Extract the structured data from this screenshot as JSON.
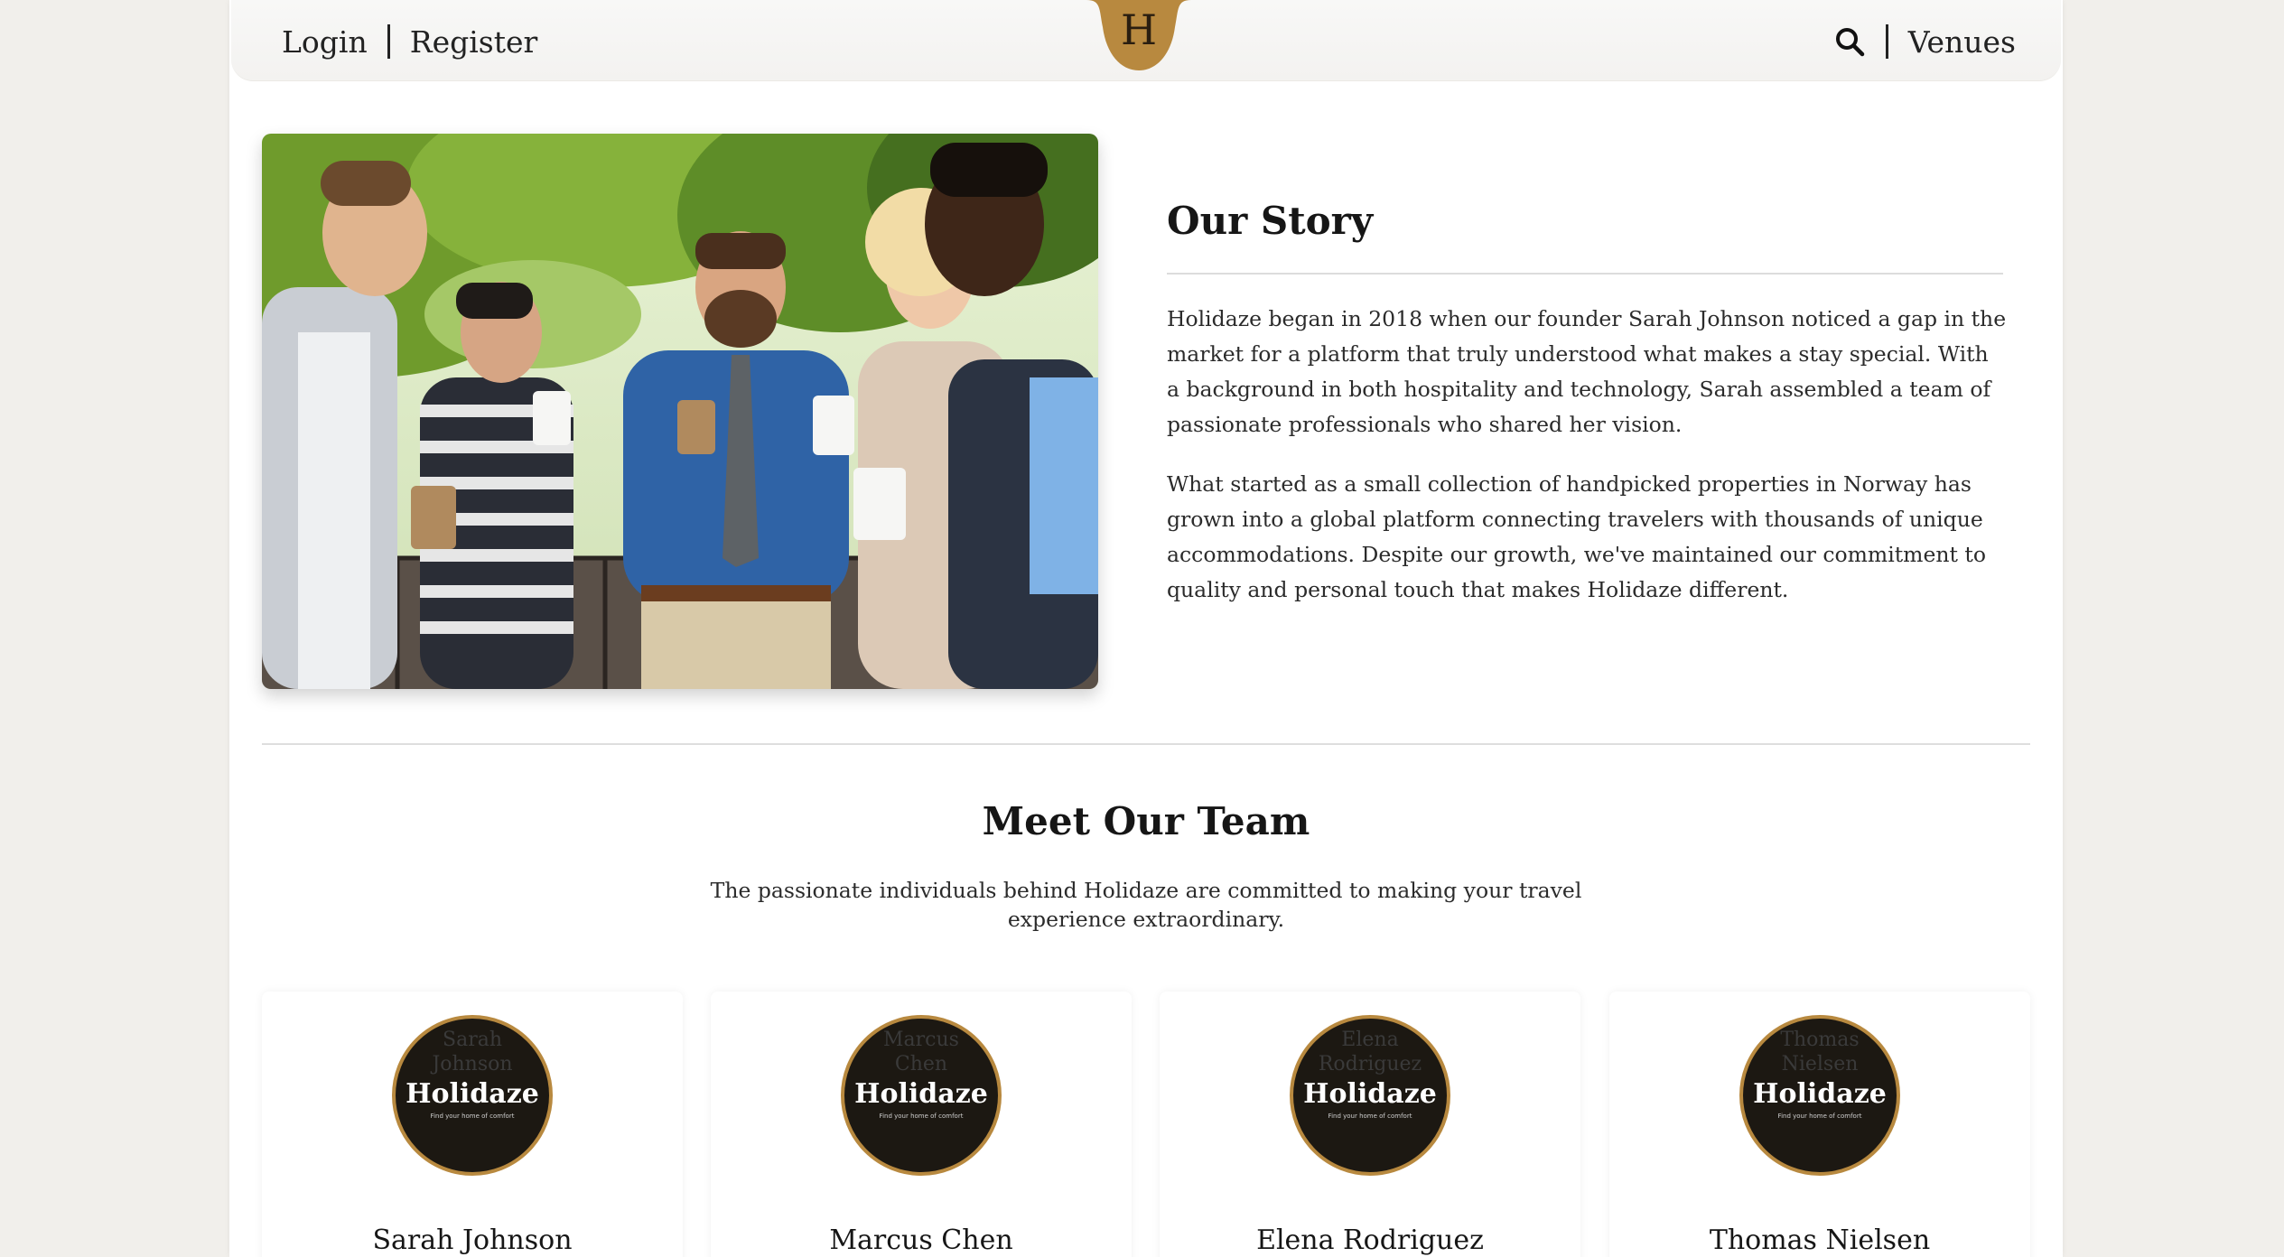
{
  "nav": {
    "login": "Login",
    "register": "Register",
    "logo_letter": "H",
    "venues": "Venues"
  },
  "colors": {
    "accent": "#b8893f",
    "avatar_bg": "#1c1812",
    "page_bg": "#f1efeb"
  },
  "story": {
    "title": "Our Story",
    "paragraphs": [
      "Holidaze began in 2018 when our founder Sarah Johnson noticed a gap in the market for a platform that truly understood what makes a stay special. With a background in both hospitality and technology, Sarah assembled a team of passionate professionals who shared her vision.",
      "What started as a small collection of handpicked properties in Norway has grown into a global platform connecting travelers with thousands of unique accommodations. Despite our growth, we've maintained our commitment to quality and personal touch that makes Holidaze different."
    ]
  },
  "team": {
    "title": "Meet Our Team",
    "subtitle": "The passionate individuals behind Holidaze are committed to making your travel experience extraordinary.",
    "members": [
      {
        "name": "Sarah Johnson",
        "avatar_alt": "Sarah Johnson",
        "brand": "Holidaze",
        "tagline": "Find your home of comfort"
      },
      {
        "name": "Marcus Chen",
        "avatar_alt": "Marcus Chen",
        "brand": "Holidaze",
        "tagline": "Find your home of comfort"
      },
      {
        "name": "Elena Rodriguez",
        "avatar_alt": "Elena Rodriguez",
        "brand": "Holidaze",
        "tagline": "Find your home of comfort"
      },
      {
        "name": "Thomas Nielsen",
        "avatar_alt": "Thomas Nielsen",
        "brand": "Holidaze",
        "tagline": "Find your home of comfort"
      }
    ]
  },
  "icons": {
    "search": "search-icon",
    "photo": "team-photo"
  }
}
